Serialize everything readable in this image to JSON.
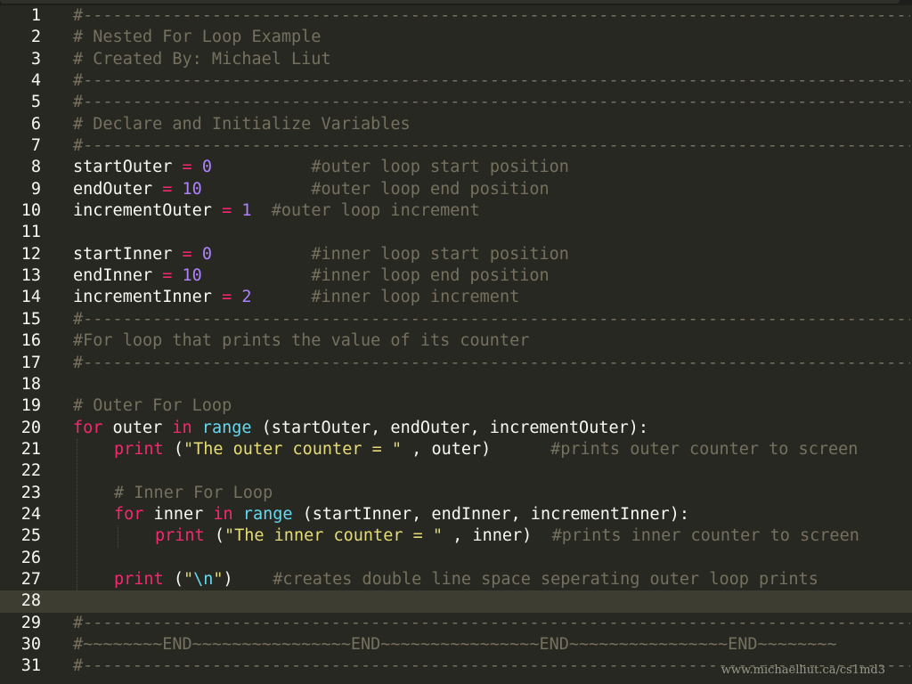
{
  "colors": {
    "background": "#272822",
    "comment": "#75715e",
    "keyword": "#f92672",
    "number": "#ae81ff",
    "builtin": "#66d9ef",
    "string": "#e6db74",
    "text": "#f8f8f2",
    "active_line": "#3e3d32"
  },
  "active_line": 28,
  "line_numbers": [
    "1",
    "2",
    "3",
    "4",
    "5",
    "6",
    "7",
    "8",
    "9",
    "10",
    "11",
    "12",
    "13",
    "14",
    "15",
    "16",
    "17",
    "18",
    "19",
    "20",
    "21",
    "22",
    "23",
    "24",
    "25",
    "26",
    "27",
    "28",
    "29",
    "30",
    "31"
  ],
  "code": {
    "sep": "#---------------------------------------------------------------------------------------------",
    "l2": "# Nested For Loop Example",
    "l3": "# Created By: Michael Liut",
    "l6": "# Declare and Initialize Variables",
    "l8": {
      "name": "startOuter",
      "op": "=",
      "val": "0",
      "pad": "          ",
      "comment": "#outer loop start position"
    },
    "l9": {
      "name": "endOuter",
      "op": "=",
      "val": "10",
      "pad": "           ",
      "comment": "#outer loop end position"
    },
    "l10": {
      "name": "incrementOuter",
      "op": "=",
      "val": "1",
      "pad": "  ",
      "comment": "#outer loop increment"
    },
    "l12": {
      "name": "startInner",
      "op": "=",
      "val": "0",
      "pad": "          ",
      "comment": "#inner loop start position"
    },
    "l13": {
      "name": "endInner",
      "op": "=",
      "val": "10",
      "pad": "           ",
      "comment": "#inner loop end position"
    },
    "l14": {
      "name": "incrementInner",
      "op": "=",
      "val": "2",
      "pad": "      ",
      "comment": "#inner loop increment"
    },
    "l16": "#For loop that prints the value of its counter",
    "l19": "# Outer For Loop",
    "l20": {
      "for": "for",
      "var": " outer ",
      "in": "in",
      "range": " range",
      "args": " (startOuter, endOuter, incrementOuter):"
    },
    "l21": {
      "print": "print",
      "open": " (",
      "str": "\"The outer counter = \"",
      "rest": " , outer)",
      "pad": "      ",
      "comment": "#prints outer counter to screen"
    },
    "l23": "# Inner For Loop",
    "l24": {
      "for": "for",
      "var": " inner ",
      "in": "in",
      "range": " range",
      "args": " (startInner, endInner, incrementInner):"
    },
    "l25": {
      "print": "print",
      "open": " (",
      "str": "\"The inner counter = \"",
      "rest": " , inner)",
      "pad": "  ",
      "comment": "#prints inner counter to screen"
    },
    "l27": {
      "print": "print",
      "open": " (",
      "q1": "\"",
      "esc": "\\n",
      "q2": "\"",
      "close": ")",
      "pad": "    ",
      "comment": "#creates double line space seperating outer loop prints"
    },
    "l30": "#~~~~~~~~END~~~~~~~~~~~~~~~~END~~~~~~~~~~~~~~~~END~~~~~~~~~~~~~~~~END~~~~~~~~"
  },
  "watermark": "www.michaelliut.ca/cs1md3"
}
